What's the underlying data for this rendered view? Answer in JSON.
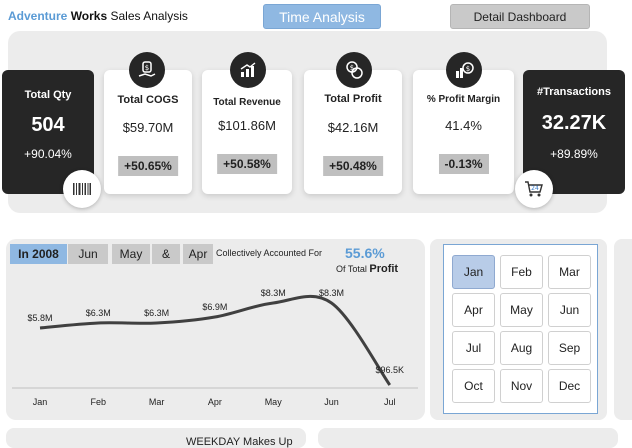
{
  "header": {
    "title_part1": "Adventure",
    "title_part2": "Works",
    "title_part3": "Sales Analysis",
    "time_button": "Time Analysis",
    "detail_button": "Detail Dashboard"
  },
  "kpis": {
    "total_qty": {
      "label": "Total Qty",
      "value": "504",
      "change": "+90.04%"
    },
    "total_cogs": {
      "label": "Total COGS",
      "value": "$59.70M",
      "change": "+50.65%"
    },
    "total_revenue": {
      "label": "Total Revenue",
      "value": "$101.86M",
      "change": "+50.58%"
    },
    "total_profit": {
      "label": "Total Profit",
      "value": "$42.16M",
      "change": "+50.48%"
    },
    "profit_margin": {
      "label": "% Profit Margin",
      "value": "41.4%",
      "change": "-0.13%"
    },
    "transactions": {
      "label": "#Transactions",
      "value": "32.27K",
      "change": "+89.89%"
    }
  },
  "filters": {
    "year": "In 2008",
    "m1": "Jun",
    "m2": "May",
    "amp": "&",
    "m3": "Apr",
    "collectively": "Collectively Accounted For",
    "percent": "55.6%",
    "of_total": "Of Total",
    "profit": "Profit"
  },
  "chart_data": {
    "type": "line",
    "categories": [
      "Jan",
      "Feb",
      "Mar",
      "Apr",
      "May",
      "Jun",
      "Jul"
    ],
    "values": [
      5.8,
      6.3,
      6.3,
      6.9,
      8.3,
      8.3,
      0.0965
    ],
    "data_labels": [
      "$5.8M",
      "$6.3M",
      "$6.3M",
      "$6.9M",
      "$8.3M",
      "$8.3M",
      "$96.5K"
    ],
    "title": "",
    "xlabel": "",
    "ylabel": "",
    "grid": false
  },
  "months": {
    "items": [
      "Jan",
      "Feb",
      "Mar",
      "Apr",
      "May",
      "Jun",
      "Jul",
      "Aug",
      "Sep",
      "Oct",
      "Nov",
      "Dec"
    ],
    "selected": "Jan"
  },
  "bottom": {
    "weekday_text": "WEEKDAY Makes Up"
  },
  "icons": {
    "qty": "barcode-icon",
    "cogs": "money-hand-icon",
    "revenue": "growth-chart-icon",
    "profit": "coins-icon",
    "margin": "dollar-growth-icon",
    "transactions": "shopping-cart-icon"
  },
  "colors": {
    "accent_blue": "#5b9bd5",
    "dark_card": "#262626",
    "panel_bg": "#ececec"
  }
}
